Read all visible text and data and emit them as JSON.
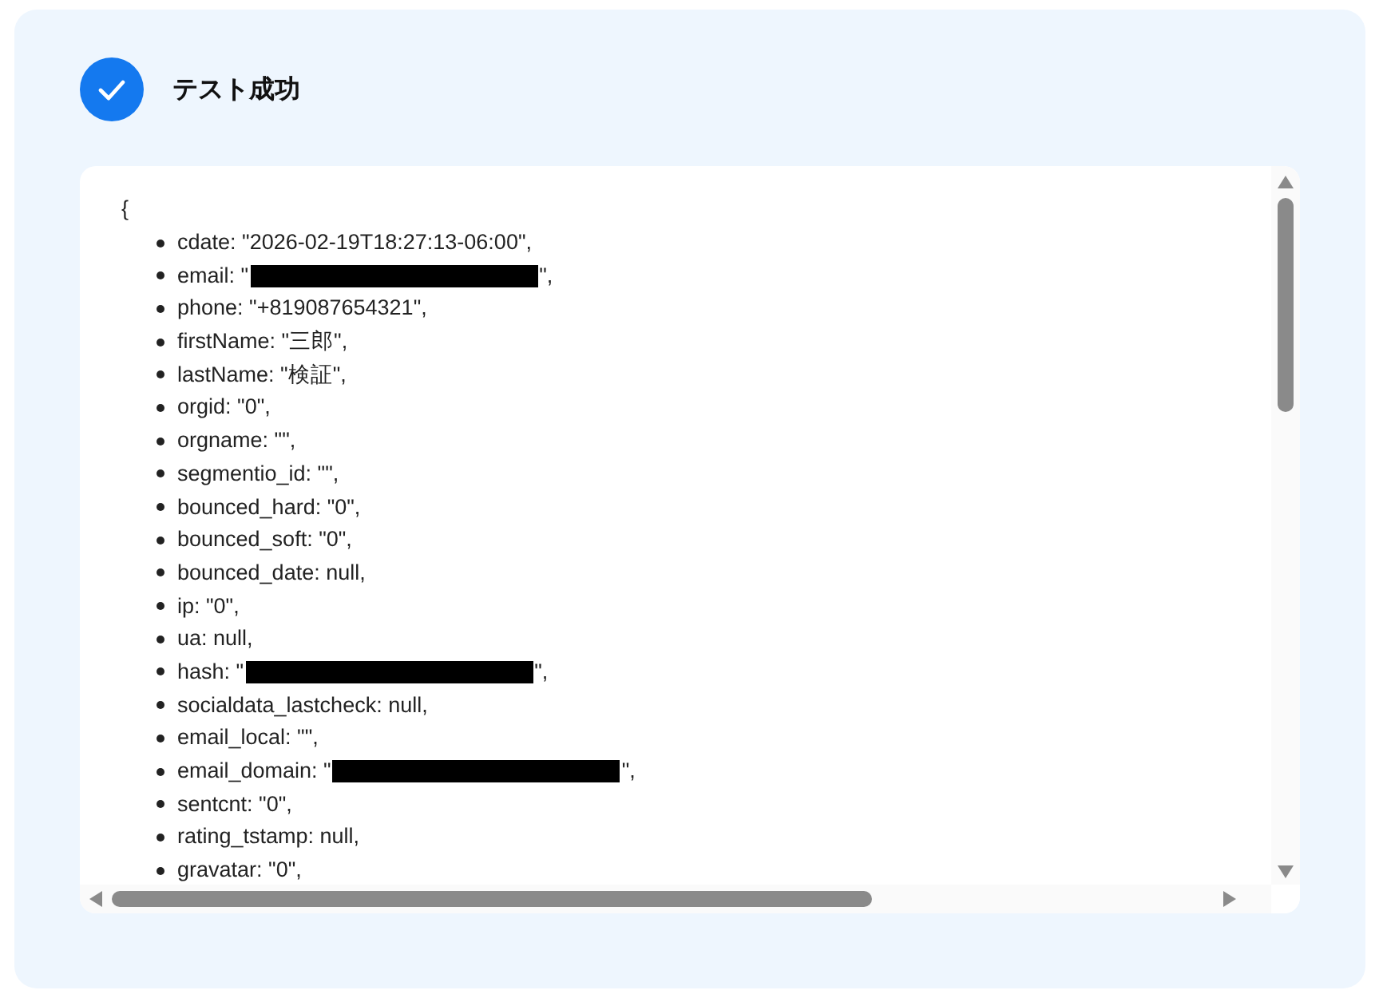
{
  "result": {
    "title": "テスト成功"
  },
  "output": {
    "opening": "{",
    "items": [
      {
        "kind": "plain",
        "text": "cdate: \"2026-02-19T18:27:13-06:00\","
      },
      {
        "kind": "redacted",
        "before": "email: \"",
        "after": "\","
      },
      {
        "kind": "plain",
        "text": "phone: \"+819087654321\","
      },
      {
        "kind": "plain",
        "text": "firstName: \"三郎\","
      },
      {
        "kind": "plain",
        "text": "lastName: \"検証\","
      },
      {
        "kind": "plain",
        "text": "orgid: \"0\","
      },
      {
        "kind": "plain",
        "text": "orgname: \"\","
      },
      {
        "kind": "plain",
        "text": "segmentio_id: \"\","
      },
      {
        "kind": "plain",
        "text": "bounced_hard: \"0\","
      },
      {
        "kind": "plain",
        "text": "bounced_soft: \"0\","
      },
      {
        "kind": "plain",
        "text": "bounced_date: null,"
      },
      {
        "kind": "plain",
        "text": "ip: \"0\","
      },
      {
        "kind": "plain",
        "text": "ua: null,"
      },
      {
        "kind": "redacted",
        "before": "hash: \"",
        "after": "\","
      },
      {
        "kind": "plain",
        "text": "socialdata_lastcheck: null,"
      },
      {
        "kind": "plain",
        "text": "email_local: \"\","
      },
      {
        "kind": "redacted",
        "before": "email_domain: \"",
        "after": "\","
      },
      {
        "kind": "plain",
        "text": "sentcnt: \"0\","
      },
      {
        "kind": "plain",
        "text": "rating_tstamp: null,"
      },
      {
        "kind": "plain",
        "text": "gravatar: \"0\","
      }
    ]
  }
}
